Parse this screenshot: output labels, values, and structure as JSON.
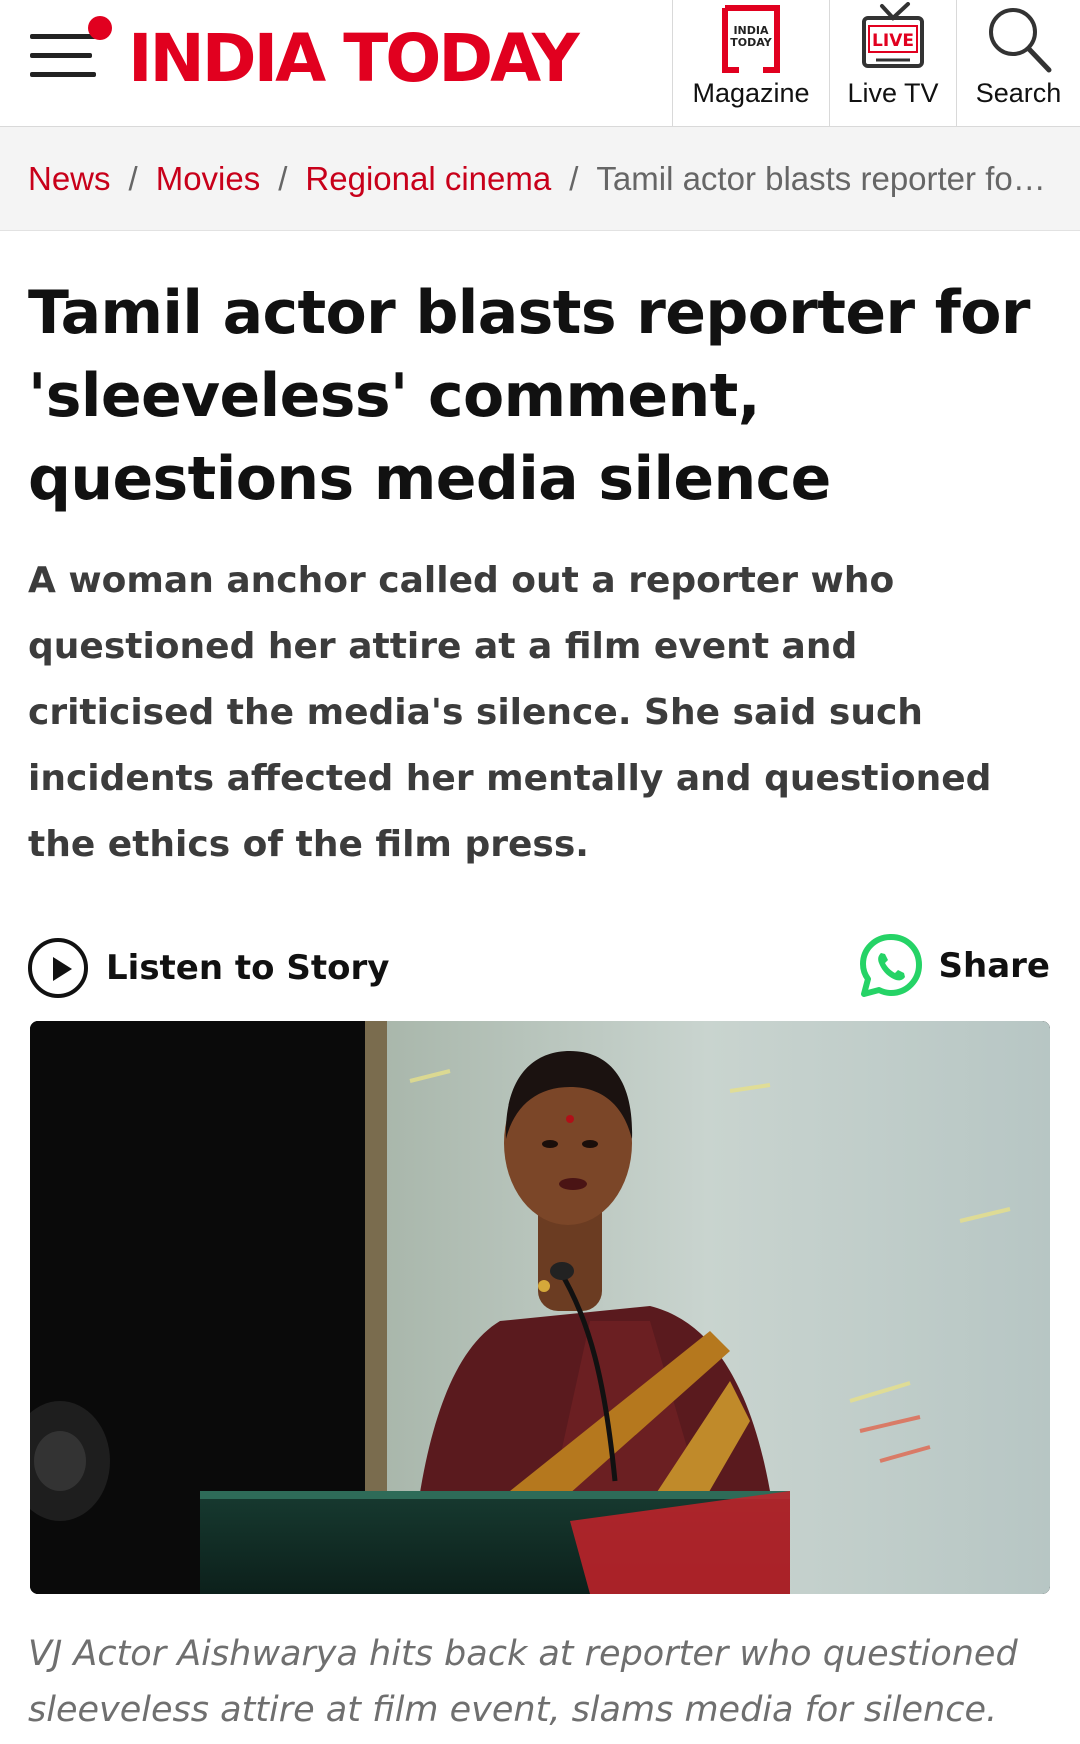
{
  "header": {
    "logo": "INDIA TODAY",
    "brand_color": "#e1001f",
    "nav": [
      {
        "label": "Magazine",
        "icon": "magazine-icon"
      },
      {
        "label": "Live TV",
        "icon": "live-tv-icon",
        "badge": "LIVE"
      },
      {
        "label": "Search",
        "icon": "search-icon"
      }
    ],
    "magazine_icon_text": "INDIA TODAY"
  },
  "breadcrumb": {
    "items": [
      "News",
      "Movies",
      "Regional cinema"
    ],
    "separator": "/",
    "current": "Tamil actor blasts reporter for 'sleeveless' comment, questions media silence"
  },
  "article": {
    "headline": "Tamil actor blasts reporter for 'sleeveless' comment, questions media silence",
    "summary": "A woman anchor called out a reporter who questioned her attire at a film event and criticised the media's silence. She said such incidents affected her mentally and questioned the ethics of the film press.",
    "listen_label": "Listen to Story",
    "share_label": "Share",
    "caption": "VJ Actor Aishwarya hits back at reporter who questioned sleeveless attire at film event, slams media for silence."
  },
  "colors": {
    "link_red": "#c8001a",
    "whatsapp_green": "#25d366"
  }
}
